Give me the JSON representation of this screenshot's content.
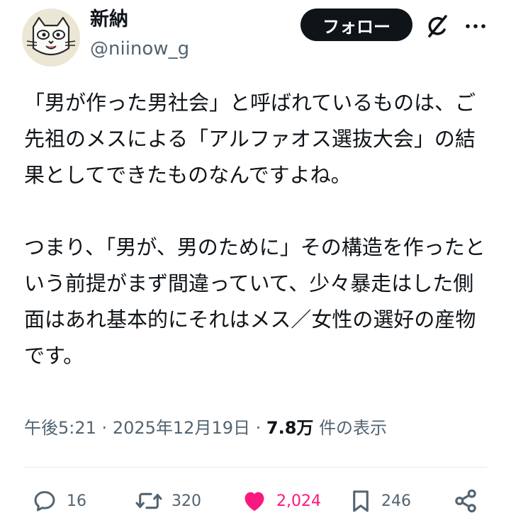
{
  "author": {
    "display_name": "新納",
    "handle": "@niinow_g",
    "avatar_icon": "cat-face-avatar"
  },
  "header": {
    "follow_label": "フォロー",
    "grok_icon": "grok-icon",
    "more_icon": "more-icon"
  },
  "post": {
    "paragraphs": [
      "「男が作った男社会」と呼ばれているものは、ご先祖のメスによる「アルファオス選抜大会」の結果としてできたものなんですよね。",
      "つまり、「男が、男のために」その構造を作ったという前提がまず間違っていて、少々暴走はした側面はあれ基本的にそれはメス／女性の選好の産物です。"
    ]
  },
  "meta": {
    "time": "午後5:21",
    "date": "2025年12月19日",
    "sep": "·",
    "views_count": "7.8万",
    "views_label": "件の表示"
  },
  "actions": {
    "replies": "16",
    "reposts": "320",
    "likes": "2,024",
    "bookmarks": "246"
  },
  "colors": {
    "text": "#0f1419",
    "secondary": "#536471",
    "like": "#f91880",
    "follow_bg": "#0f1419"
  }
}
